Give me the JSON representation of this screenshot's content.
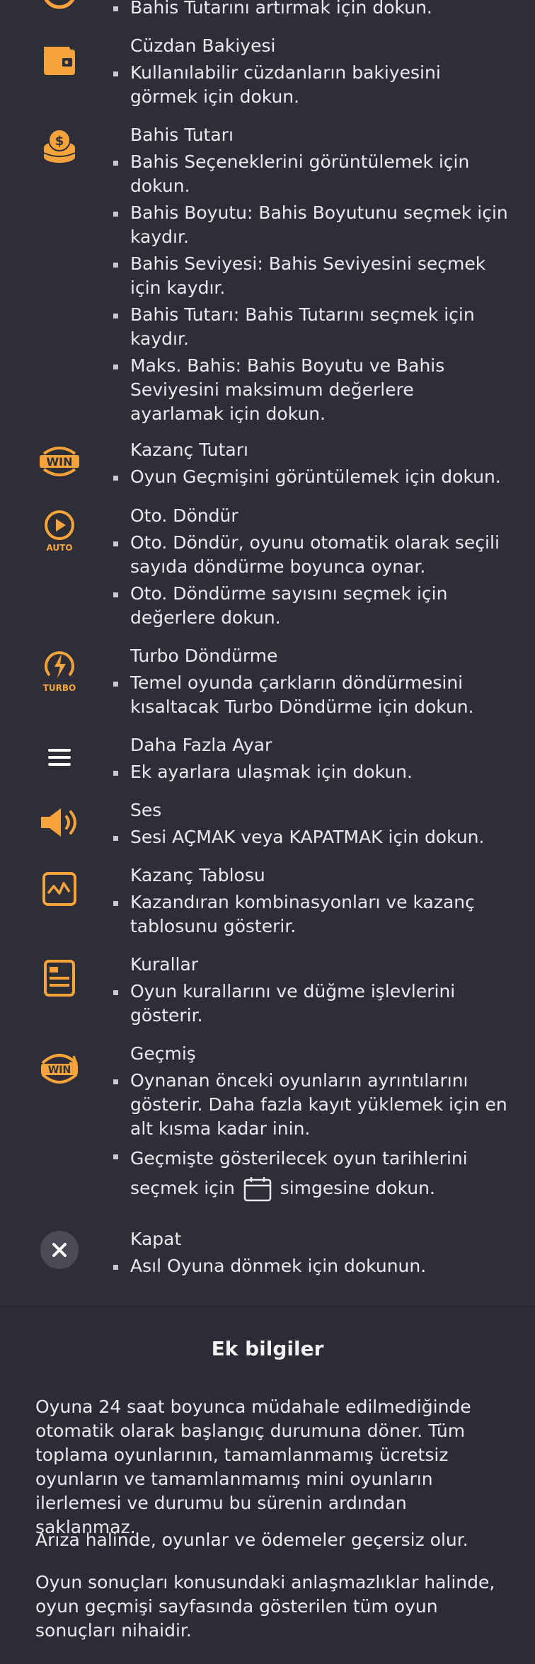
{
  "items": [
    {
      "id": "top",
      "title": "",
      "bullets": [
        "Bahis Tutarını artırmak için dokun."
      ],
      "icon": "coin-plus-icon"
    },
    {
      "id": "wallet",
      "title": "Cüzdan Bakiyesi",
      "bullets": [
        "Kullanılabilir cüzdanların bakiyesini görmek için dokun."
      ],
      "icon": "wallet-icon"
    },
    {
      "id": "bet",
      "title": "Bahis Tutarı",
      "bullets": [
        "Bahis Seçeneklerini görüntülemek için dokun.",
        "Bahis Boyutu: Bahis Boyutunu seçmek için kaydır.",
        "Bahis Seviyesi: Bahis Seviyesini seçmek için kaydır.",
        "Bahis Tutarı: Bahis Tutarını seçmek için kaydır.",
        "Maks. Bahis: Bahis Boyutu ve Bahis Seviyesini maksimum değerlere ayarlamak için dokun."
      ],
      "icon": "coin-stack-icon"
    },
    {
      "id": "win",
      "title": "Kazanç Tutarı",
      "bullets": [
        "Oyun Geçmişini görüntülemek için dokun."
      ],
      "icon": "win-icon"
    },
    {
      "id": "auto",
      "title": "Oto. Döndür",
      "bullets": [
        "Oto. Döndür, oyunu otomatik olarak seçili sayıda döndürme boyunca oynar.",
        "Oto. Döndürme sayısını seçmek için değerlere dokun."
      ],
      "icon": "auto-spin-icon"
    },
    {
      "id": "turbo",
      "title": "Turbo Döndürme",
      "bullets": [
        "Temel oyunda çarkların döndürmesini kısaltacak Turbo Döndürme için dokun."
      ],
      "icon": "turbo-icon"
    },
    {
      "id": "menu",
      "title": "Daha Fazla Ayar",
      "bullets": [
        "Ek ayarlara ulaşmak için dokun."
      ],
      "icon": "menu-icon"
    },
    {
      "id": "sound",
      "title": "Ses",
      "bullets": [
        "Sesi AÇMAK veya KAPATMAK için dokun."
      ],
      "icon": "speaker-icon"
    },
    {
      "id": "paytable",
      "title": "Kazanç Tablosu",
      "bullets": [
        "Kazandıran kombinasyonları ve kazanç tablosunu gösterir."
      ],
      "icon": "paytable-icon"
    },
    {
      "id": "rules",
      "title": "Kurallar",
      "bullets": [
        "Oyun kurallarını ve düğme işlevlerini gösterir."
      ],
      "icon": "rules-icon"
    },
    {
      "id": "history",
      "title": "Geçmiş",
      "bullets": [
        "Oynanan önceki oyunların ayrıntılarını gösterir. Daha fazla kayıt yüklemek için en alt kısma kadar inin."
      ],
      "history_extra": {
        "line1": "Geçmişte gösterilecek oyun tarihlerini",
        "before": "seçmek için",
        "after": "simgesine dokun."
      },
      "icon": "history-win-icon"
    },
    {
      "id": "close",
      "title": "Kapat",
      "bullets": [
        "Asıl Oyuna dönmek için dokunun."
      ],
      "icon": "close-icon"
    }
  ],
  "info": {
    "title": "Ek bilgiler",
    "p1": "Oyuna 24 saat boyunca müdahale edilmediğinde otomatik olarak başlangıç durumuna döner. Tüm toplama oyunlarının, tamamlanmamış ücretsiz oyunların ve tamamlanmamış mini oyunların ilerlemesi ve durumu bu sürenin ardından saklanmaz.",
    "p2": "Arıza halinde, oyunlar ve ödemeler geçersiz olur.",
    "p3": "Oyun sonuçları konusundaki anlaşmazlıklar halinde, oyun geçmişi sayfasında gösterilen tüm oyun sonuçları nihaidir."
  },
  "colors": {
    "accent": "#f5a33a",
    "bg": "#2d2e38",
    "close_bg": "#4a4b56"
  }
}
